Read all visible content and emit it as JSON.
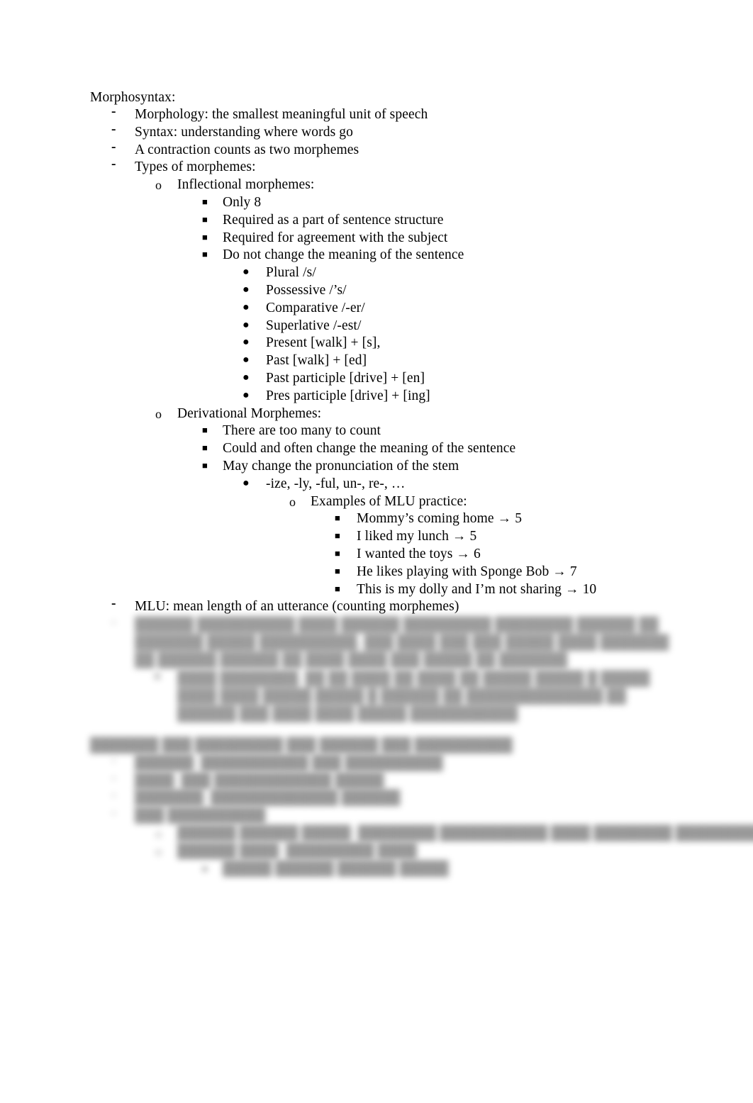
{
  "document": {
    "heading": "Morphosyntax:",
    "outline": [
      {
        "level": 1,
        "marker": "dash",
        "text": "Morphology: the smallest meaningful unit of speech"
      },
      {
        "level": 1,
        "marker": "dash",
        "text": "Syntax: understanding where words go"
      },
      {
        "level": 1,
        "marker": "dash",
        "text": "A contraction counts as two morphemes"
      },
      {
        "level": 1,
        "marker": "dash",
        "text": "Types of morphemes:"
      },
      {
        "level": 2,
        "marker": "circle-hollow",
        "text": "Inflectional morphemes:"
      },
      {
        "level": 3,
        "marker": "square-filled",
        "text": "Only 8"
      },
      {
        "level": 3,
        "marker": "square-filled",
        "text": "Required as a part of sentence structure"
      },
      {
        "level": 3,
        "marker": "square-filled",
        "text": "Required for agreement with the subject"
      },
      {
        "level": 3,
        "marker": "square-filled",
        "text": "Do not change the meaning of the sentence"
      },
      {
        "level": 4,
        "marker": "circle-filled",
        "text": "Plural /s/"
      },
      {
        "level": 4,
        "marker": "circle-filled",
        "text": "Possessive /’s/"
      },
      {
        "level": 4,
        "marker": "circle-filled",
        "text": "Comparative /-er/"
      },
      {
        "level": 4,
        "marker": "circle-filled",
        "text": "Superlative /-est/"
      },
      {
        "level": 4,
        "marker": "circle-filled",
        "text": "Present [walk] + [s],"
      },
      {
        "level": 4,
        "marker": "circle-filled",
        "text": "Past [walk] + [ed]"
      },
      {
        "level": 4,
        "marker": "circle-filled",
        "text": "Past participle [drive] + [en]"
      },
      {
        "level": 4,
        "marker": "circle-filled",
        "text": "Pres participle [drive] + [ing]"
      },
      {
        "level": 2,
        "marker": "circle-hollow",
        "text": "Derivational Morphemes:"
      },
      {
        "level": 3,
        "marker": "square-filled",
        "text": "There are too many to count"
      },
      {
        "level": 3,
        "marker": "square-filled",
        "text": "Could and often change the meaning of the sentence"
      },
      {
        "level": 3,
        "marker": "square-filled",
        "text": "May change the pronunciation of the stem"
      },
      {
        "level": 4,
        "marker": "circle-filled",
        "text": "-ize, -ly, -ful, un-, re-, …"
      },
      {
        "level": 5,
        "marker": "circle-hollow",
        "text": "Examples of MLU practice:"
      },
      {
        "level": 6,
        "marker": "square-filled",
        "text": "Mommy’s coming home → 5"
      },
      {
        "level": 6,
        "marker": "square-filled",
        "text": "I liked my lunch → 5"
      },
      {
        "level": 6,
        "marker": "square-filled",
        "text": "I wanted the toys → 6"
      },
      {
        "level": 6,
        "marker": "square-filled",
        "text": "He likes playing with Sponge Bob → 7"
      },
      {
        "level": 6,
        "marker": "square-filled",
        "text": "This is my dolly and I’m not sharing → 10"
      },
      {
        "level": 1,
        "marker": "dash",
        "text": "MLU: mean length of an utterance (counting morphemes)"
      }
    ],
    "markers": {
      "dash": "-",
      "circle-hollow": "o",
      "square-filled": "■",
      "circle-filled": "●"
    },
    "redacted_region": {
      "note": "blurred illegible text",
      "blocks": [
        {
          "indent": 190,
          "marker": "-",
          "lines": [
            "██████  ██████████  ████  ██████ █████████ ████████ ██████ ██ ███████",
            "█████ ██████████,  ███ ████ ███ ███ █████  ████ ███████ ██ ██████ ██████ ██",
            "████ ████ ███ █████ ██ ███████"
          ]
        },
        {
          "indent": 250,
          "marker": "o",
          "lines": [
            "████ ████████,  ██ ██ ████ ██ ████ ██ █████ █████  █ █████ ████ ████ █████ █████",
            "█ ██████ ██ ██████████████ ██ ██████ ███ ████ ████ █████",
            "███████████"
          ]
        }
      ],
      "lower_blocks": [
        {
          "indent": 127,
          "marker": "",
          "text": "███████ ███ █████████ ███ ██████ ███ ██████████"
        },
        {
          "indent": 190,
          "marker": "-",
          "text": "██████: ███████████ ███ ██████████"
        },
        {
          "indent": 190,
          "marker": "-",
          "text": "████: ███ ████████████ █████"
        },
        {
          "indent": 190,
          "marker": "-",
          "text": "███████: █████████████ ██████"
        },
        {
          "indent": 190,
          "marker": "-",
          "text": "███ ██████████"
        },
        {
          "indent": 250,
          "marker": "o",
          "text": "██████ ██████ █████: ████████ ███████████ ████ ████████ ███████████"
        },
        {
          "indent": 250,
          "marker": "o",
          "text": "██████ ████: █████████ ████"
        },
        {
          "indent": 314,
          "marker": "■",
          "text": "█████ ██████ ██████ █████"
        }
      ]
    }
  }
}
